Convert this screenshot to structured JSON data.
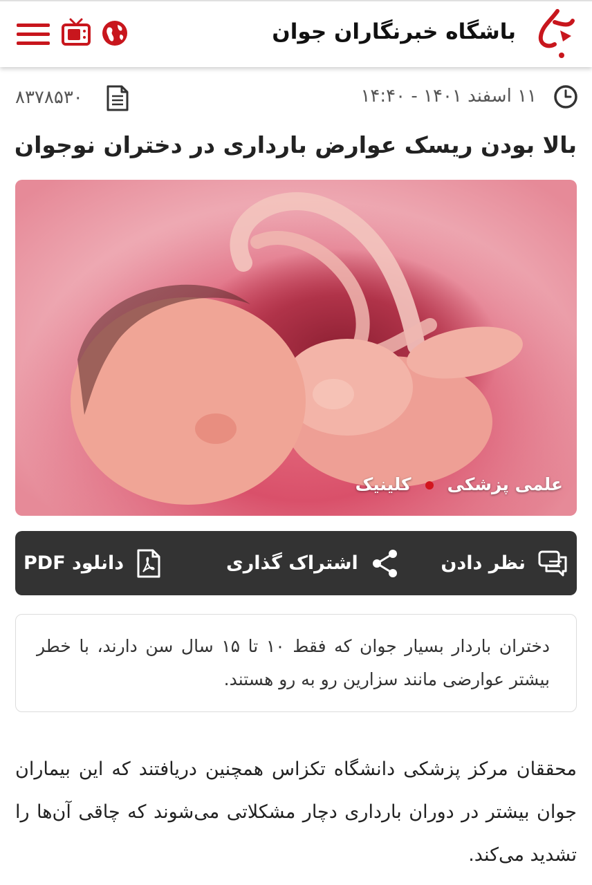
{
  "header": {
    "site_name": "باشگاه خبرنگاران جوان",
    "brand_color": "#c8161d"
  },
  "meta": {
    "date_time": "۱۱ اسفند ۱۴۰۱ - ۱۴:۴۰",
    "news_id": "۸۳۷۸۵۳۰"
  },
  "article": {
    "title": "بالا بودن ریسک عوارض بارداری در دختران نوجوان",
    "tag_1": "علمی پزشکی",
    "tag_2": "کلینیک",
    "lead": "دختران باردار بسیار جوان که فقط ۱۰ تا ۱۵ سال سن دارند، با خطر بیشتر عوارضی مانند سزارین رو به رو هستند.",
    "body": "محققان مرکز پزشکی دانشگاه تکزاس همچنین دریافتند که این بیماران جوان بیشتر در دوران بارداری دچار مشکلاتی می‌شوند که چاقی آن‌ها را تشدید می‌کند."
  },
  "actions": {
    "comment_label": "نظر دادن",
    "share_label": "اشتراک گذاری",
    "pdf_label": "دانلود PDF"
  }
}
